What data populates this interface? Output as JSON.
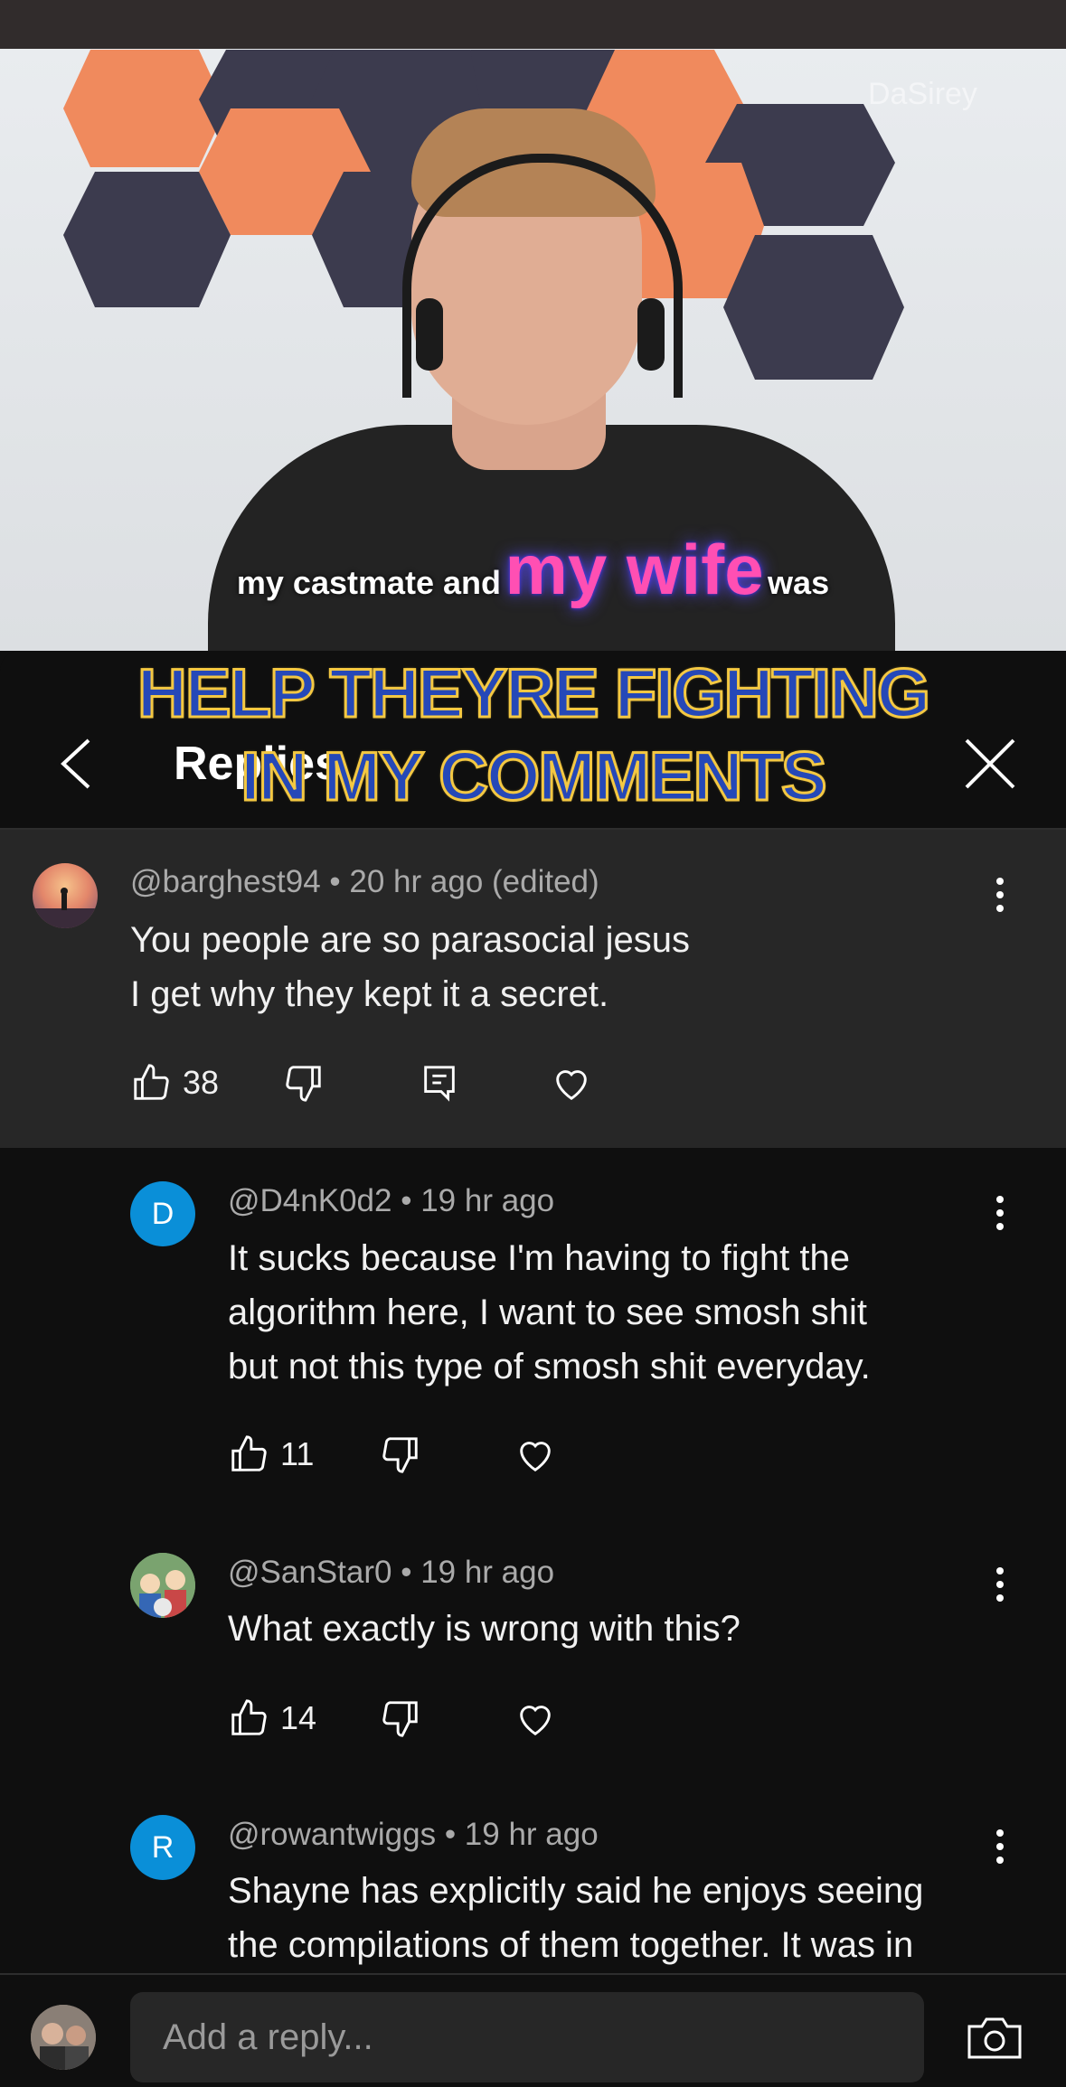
{
  "video": {
    "caption_part1": "my castmate and",
    "caption_highlight": "my wife",
    "caption_part2": "was",
    "watermark": "DaSirey"
  },
  "overlay": {
    "line1": "HELP THEYRE FIGHTING",
    "line2": "IN MY COMMENTS"
  },
  "header": {
    "title": "Replies"
  },
  "parent_comment": {
    "handle": "@barghest94",
    "time": "20 hr ago (edited)",
    "lines": [
      "You people are so parasocial jesus",
      "I get why they kept it a secret."
    ],
    "likes": "38"
  },
  "replies": [
    {
      "avatar_letter": "D",
      "handle": "@D4nK0d2",
      "time": "19 hr ago",
      "lines": [
        "It sucks because I'm having to fight the",
        "algorithm here, I want to see smosh shit",
        "but not this type of smosh shit everyday."
      ],
      "likes": "11"
    },
    {
      "handle": "@SanStar0",
      "time": "19 hr ago",
      "lines": [
        "What exactly is wrong with this?"
      ],
      "likes": "14"
    },
    {
      "avatar_letter": "R",
      "handle": "@rowantwiggs",
      "time": "19 hr ago",
      "lines": [
        "Shayne has explicitly said he enjoys seeing",
        "the compilations of them together. It was in"
      ]
    }
  ],
  "footer": {
    "placeholder": "Add a reply..."
  },
  "colors": {
    "background": "#0f0f0f",
    "parent_background": "#272727",
    "letter_avatar": "#0a8fd8",
    "caption_highlight": "#ff4fb3",
    "overlay_text": "#2548b8",
    "overlay_outline": "#f4c842"
  },
  "icons": [
    "back-icon",
    "close-icon",
    "thumbs-up-icon",
    "thumbs-down-icon",
    "reply-icon",
    "heart-icon",
    "more-vertical-icon",
    "camera-icon"
  ]
}
